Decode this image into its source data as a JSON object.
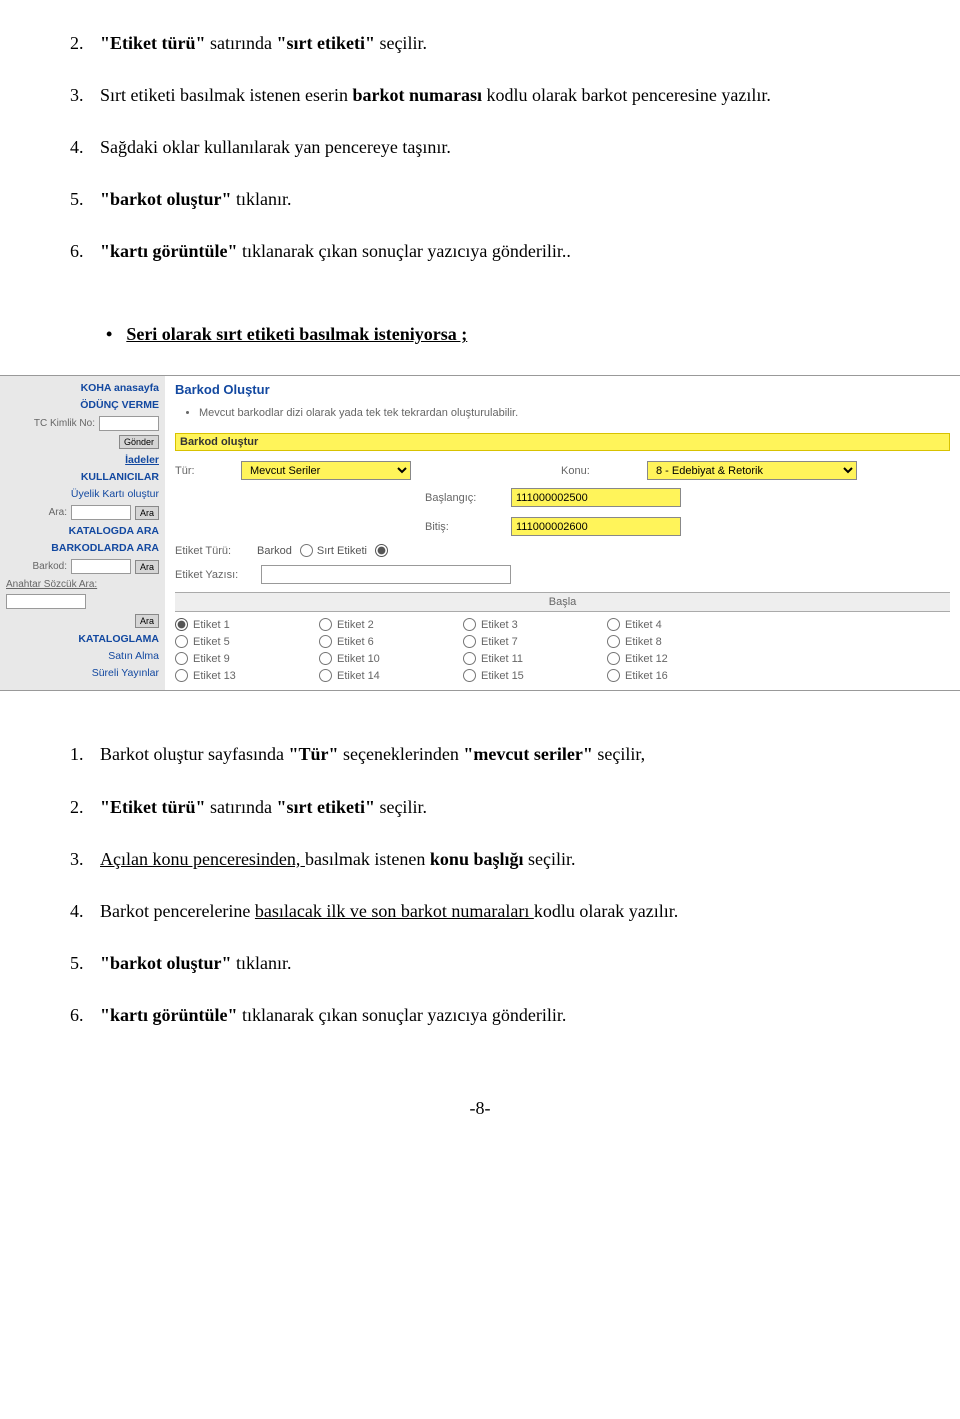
{
  "doc": {
    "top_list": [
      {
        "n": "2.",
        "text_parts": [
          {
            "b": true,
            "t": "\"Etiket türü\" "
          },
          {
            "t": "satırında "
          },
          {
            "b": true,
            "t": "\"sırt etiketi\" "
          },
          {
            "t": "seçilir."
          }
        ]
      },
      {
        "n": "3.",
        "text_parts": [
          {
            "t": "Sırt etiketi basılmak istenen eserin "
          },
          {
            "b": true,
            "t": "barkot numarası "
          },
          {
            "t": "kodlu olarak barkot penceresine yazılır."
          }
        ]
      },
      {
        "n": "4.",
        "text_parts": [
          {
            "t": "Sağdaki oklar kullanılarak yan pencereye taşınır."
          }
        ]
      },
      {
        "n": "5.",
        "text_parts": [
          {
            "b": true,
            "t": "\"barkot oluştur\" "
          },
          {
            "t": "tıklanır."
          }
        ]
      },
      {
        "n": "6.",
        "text_parts": [
          {
            "b": true,
            "t": "\"kartı görüntüle\" "
          },
          {
            "t": "tıklanarak çıkan sonuçlar yazıcıya gönderilir.."
          }
        ]
      }
    ],
    "bullet": "Seri olarak sırt etiketi basılmak isteniyorsa ;",
    "bottom_list": [
      {
        "n": "1.",
        "text_parts": [
          {
            "t": "Barkot oluştur sayfasında "
          },
          {
            "b": true,
            "t": "\"Tür\" "
          },
          {
            "t": "seçeneklerinden "
          },
          {
            "b": true,
            "t": "\"mevcut seriler\" "
          },
          {
            "t": "seçilir,"
          }
        ]
      },
      {
        "n": "2.",
        "text_parts": [
          {
            "b": true,
            "t": "\"Etiket türü\" "
          },
          {
            "t": "satırında "
          },
          {
            "b": true,
            "t": "\"sırt etiketi\" "
          },
          {
            "t": "seçilir."
          }
        ]
      },
      {
        "n": "3.",
        "text_parts": [
          {
            "u": true,
            "t": "Açılan konu penceresinden, "
          },
          {
            "t": "basılmak istenen "
          },
          {
            "b": true,
            "t": "konu başlığı "
          },
          {
            "t": "seçilir."
          }
        ]
      },
      {
        "n": "4.",
        "text_parts": [
          {
            "t": "Barkot pencerelerine "
          },
          {
            "u": true,
            "t": "basılacak ilk ve son barkot numaraları "
          },
          {
            "t": "kodlu olarak yazılır."
          }
        ]
      },
      {
        "n": "5.",
        "text_parts": [
          {
            "b": true,
            "t": "\"barkot oluştur\" "
          },
          {
            "t": "tıklanır."
          }
        ]
      },
      {
        "n": "6.",
        "text_parts": [
          {
            "b": true,
            "t": "\"kartı görüntüle\" "
          },
          {
            "t": "tıklanarak çıkan sonuçlar yazıcıya gönderilir."
          }
        ]
      }
    ],
    "page_number": "-8-"
  },
  "screenshot": {
    "sidebar": {
      "link_koha": "KOHA anasayfa",
      "link_odunc": "ÖDÜNÇ VERME",
      "tc_label": "TC Kimlik No:",
      "btn_gonder": "Gönder",
      "link_iade": "İadeler",
      "link_kullan": "KULLANICILAR",
      "link_uyelik": "Üyelik Kartı oluştur",
      "ara_label": "Ara:",
      "btn_ara": "Ara",
      "link_katalog": "KATALOGDA ARA",
      "link_barkod": "BARKODLARDA ARA",
      "barkod_label": "Barkod:",
      "anahtar_label": "Anahtar Sözcük Ara:",
      "link_kataloglama": "KATALOGLAMA",
      "link_satin": "Satın Alma",
      "link_sureli": "Süreli Yayınlar"
    },
    "main": {
      "title": "Barkod Oluştur",
      "note": "Mevcut barkodlar dizi olarak yada tek tek tekrardan oluşturulabilir.",
      "section_bar": "Barkod oluştur",
      "tur_label": "Tür:",
      "tur_value": "Mevcut Seriler",
      "konu_label": "Konu:",
      "konu_value": "8 - Edebiyat & Retorik",
      "baslangic_label": "Başlangıç:",
      "baslangic_value": "111000002500",
      "bitis_label": "Bitiş:",
      "bitis_value": "111000002600",
      "etiket_turu_label": "Etiket Türü:",
      "opt_barkod": "Barkod",
      "opt_sirt": "Sırt Etiketi",
      "etiket_yazisi_label": "Etiket Yazısı:",
      "basla": "Başla",
      "etiket_grid": [
        "Etiket 1",
        "Etiket 2",
        "Etiket 3",
        "Etiket 4",
        "Etiket 5",
        "Etiket 6",
        "Etiket 7",
        "Etiket 8",
        "Etiket 9",
        "Etiket 10",
        "Etiket 11",
        "Etiket 12",
        "Etiket 13",
        "Etiket 14",
        "Etiket 15",
        "Etiket 16"
      ]
    }
  }
}
